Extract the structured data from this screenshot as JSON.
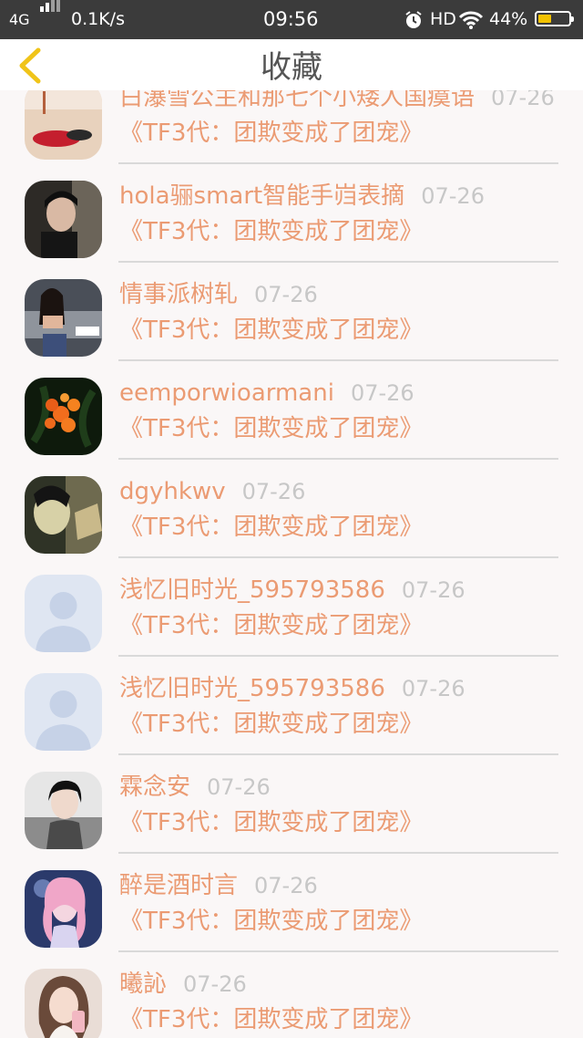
{
  "status_bar": {
    "network": "4G",
    "speed": "0.1K/s",
    "time": "09:56",
    "hd": "HD",
    "battery_pct": "44%",
    "battery_level": 0.44
  },
  "nav": {
    "title": "收藏",
    "back_icon": "chevron-left-icon"
  },
  "colors": {
    "accent": "#eb9b73",
    "date": "#c7c7c7",
    "back": "#f0c419"
  },
  "items": [
    {
      "user": "白瀑雪公主和那七个小矮人国瘼语",
      "date": "07-26",
      "title": "《TF3代：团欺变成了团宠》"
    },
    {
      "user": "hola骊smart智能手岿表摘",
      "date": "07-26",
      "title": "《TF3代：团欺变成了团宠》"
    },
    {
      "user": "情事派树轧",
      "date": "07-26",
      "title": "《TF3代：团欺变成了团宠》"
    },
    {
      "user": "eemporwioarmani",
      "date": "07-26",
      "title": "《TF3代：团欺变成了团宠》"
    },
    {
      "user": "dgyhkwv",
      "date": "07-26",
      "title": "《TF3代：团欺变成了团宠》"
    },
    {
      "user": "浅忆旧时光_595793586",
      "date": "07-26",
      "title": "《TF3代：团欺变成了团宠》"
    },
    {
      "user": "浅忆旧时光_595793586",
      "date": "07-26",
      "title": "《TF3代：团欺变成了团宠》"
    },
    {
      "user": "霖念安",
      "date": "07-26",
      "title": "《TF3代：团欺变成了团宠》"
    },
    {
      "user": "醉是酒时言",
      "date": "07-26",
      "title": "《TF3代：团欺变成了团宠》"
    },
    {
      "user": "曦訫",
      "date": "07-26",
      "title": "《TF3代：团欺变成了团宠》"
    }
  ]
}
